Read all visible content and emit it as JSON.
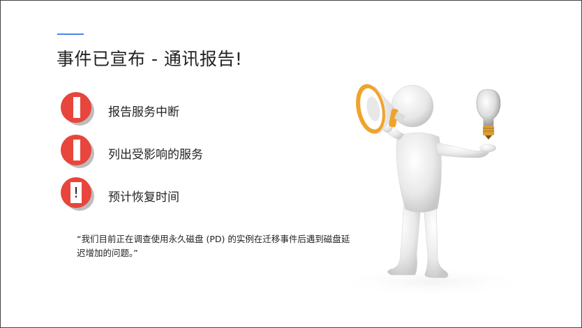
{
  "slide": {
    "title": "事件已宣布 - 通讯报告!",
    "bullets": [
      {
        "text": "报告服务中断",
        "icon": "exclamation-bar-icon"
      },
      {
        "text": "列出受影响的服务",
        "icon": "exclamation-bar-icon"
      },
      {
        "text": "预计恢复时间",
        "icon": "exclamation-mark-icon",
        "glyph": "!"
      }
    ],
    "quote": "“我们目前正在调查使用永久磁盘 (PD) 的实例在迁移事件后遇到磁盘延迟增加的问题。”"
  },
  "colors": {
    "accent": "#4a86e8",
    "bullet_red": "#e8453c",
    "bullet_shadow": "#bdbdbd",
    "megaphone_orange": "#f0a32c"
  },
  "illustration": {
    "name": "person-with-megaphone-and-lightbulb"
  }
}
